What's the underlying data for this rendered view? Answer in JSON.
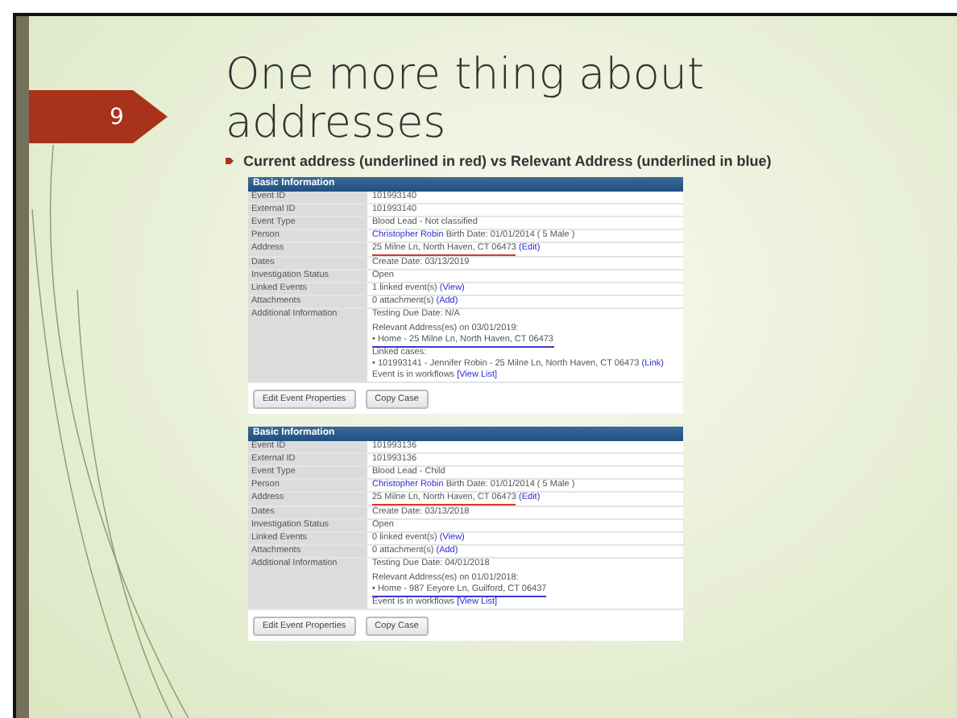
{
  "slide": {
    "number": "9",
    "title": "One more thing about addresses",
    "bullet": "Current address (underlined in red) vs Relevant Address (underlined in blue)"
  },
  "panels": [
    {
      "header": "Basic Information",
      "rows": [
        {
          "label": "Event ID",
          "lines": [
            [
              {
                "text": "101993140"
              }
            ]
          ]
        },
        {
          "label": "External ID",
          "lines": [
            [
              {
                "text": "101993140"
              }
            ]
          ]
        },
        {
          "label": "Event Type",
          "lines": [
            [
              {
                "text": "Blood Lead - Not classified"
              }
            ]
          ]
        },
        {
          "label": "Person",
          "lines": [
            [
              {
                "text": "Christopher Robin",
                "link": true
              },
              {
                "text": " Birth Date: 01/01/2014 ( 5 Male )"
              }
            ]
          ]
        },
        {
          "label": "Address",
          "lines": [
            [
              {
                "text": "25 Milne Ln, North Haven, CT 06473",
                "color": "#d03a2a"
              },
              {
                "text": " (Edit)",
                "link": true
              }
            ]
          ]
        },
        {
          "label": "Dates",
          "lines": [
            [
              {
                "text": "Create Date: 03/13/2019"
              }
            ]
          ]
        },
        {
          "label": "Investigation Status",
          "lines": [
            [
              {
                "text": "Open"
              }
            ]
          ]
        },
        {
          "label": "Linked Events",
          "lines": [
            [
              {
                "text": "1 linked event(s) "
              },
              {
                "text": "(View)",
                "link": true
              }
            ]
          ]
        },
        {
          "label": "Attachments",
          "lines": [
            [
              {
                "text": "0 attachment(s) "
              },
              {
                "text": "(Add)",
                "link": true
              }
            ]
          ]
        },
        {
          "label": "Additional Information",
          "lines": [
            [
              {
                "text": "Testing Due Date: N/A"
              }
            ],
            [
              {
                "text": "Relevant Address(es) on 03/01/2019:"
              }
            ],
            [
              {
                "text": "• Home - 25 Milne Ln, North Haven, CT 06473",
                "color": "#3a3acc"
              }
            ],
            [
              {
                "text": "Linked cases:"
              }
            ],
            [
              {
                "text": "• 101993141 - Jennifer Robin - 25 Milne Ln, North Haven, CT 06473 "
              },
              {
                "text": "(Link)",
                "link": true
              }
            ],
            [
              {
                "text": "Event is in workflows "
              },
              {
                "text": "[View List]",
                "link": true
              }
            ]
          ]
        }
      ],
      "buttons": [
        "Edit Event Properties",
        "Copy Case"
      ]
    },
    {
      "header": "Basic Information",
      "rows": [
        {
          "label": "Event ID",
          "lines": [
            [
              {
                "text": "101993136"
              }
            ]
          ]
        },
        {
          "label": "External ID",
          "lines": [
            [
              {
                "text": "101993136"
              }
            ]
          ]
        },
        {
          "label": "Event Type",
          "lines": [
            [
              {
                "text": "Blood Lead - Child"
              }
            ]
          ]
        },
        {
          "label": "Person",
          "lines": [
            [
              {
                "text": "Christopher Robin",
                "link": true
              },
              {
                "text": " Birth Date: 01/01/2014 ( 5 Male )"
              }
            ]
          ]
        },
        {
          "label": "Address",
          "lines": [
            [
              {
                "text": "25 Milne Ln, North Haven, CT 06473",
                "color": "#d03a2a"
              },
              {
                "text": " (Edit)",
                "link": true
              }
            ]
          ]
        },
        {
          "label": "Dates",
          "lines": [
            [
              {
                "text": "Create Date: 03/13/2018"
              }
            ]
          ]
        },
        {
          "label": "Investigation Status",
          "lines": [
            [
              {
                "text": "Open"
              }
            ]
          ]
        },
        {
          "label": "Linked Events",
          "lines": [
            [
              {
                "text": "0 linked event(s) "
              },
              {
                "text": "(View)",
                "link": true
              }
            ]
          ]
        },
        {
          "label": "Attachments",
          "lines": [
            [
              {
                "text": "0 attachment(s) "
              },
              {
                "text": "(Add)",
                "link": true
              }
            ]
          ]
        },
        {
          "label": "Additional Information",
          "lines": [
            [
              {
                "text": "Testing Due Date: 04/01/2018"
              }
            ],
            [
              {
                "text": "Relevant Address(es) on 01/01/2018:"
              }
            ],
            [
              {
                "text": "• Home - 987 Eeyore Ln, Guilford, CT 06437",
                "color": "#3a3acc"
              }
            ],
            [
              {
                "text": "Event is in workflows "
              },
              {
                "text": "[View List]",
                "link": true
              }
            ]
          ]
        }
      ],
      "buttons": [
        "Edit Event Properties",
        "Copy Case"
      ]
    }
  ]
}
